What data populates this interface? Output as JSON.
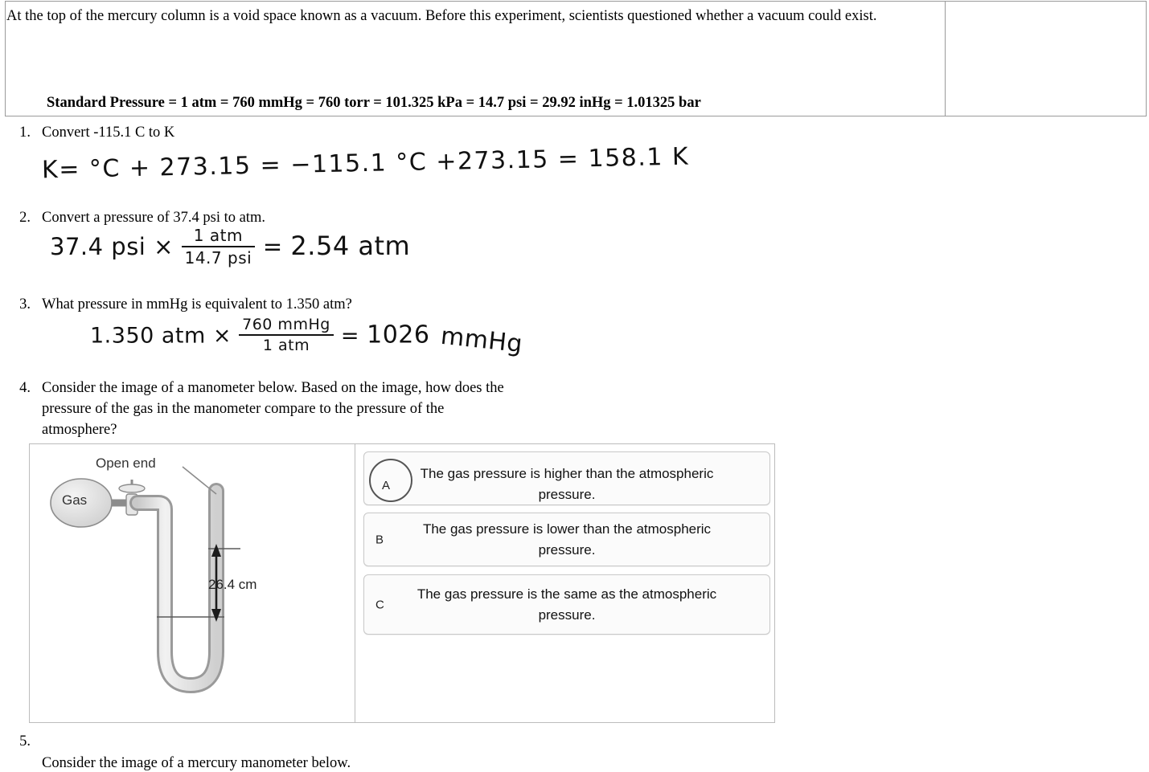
{
  "top": {
    "paragraph": "At the top of the mercury column is a void space known as a vacuum. Before this experiment, scientists questioned whether a vacuum could exist.",
    "standard_pressure": "Standard Pressure = 1 atm = 760 mmHg = 760 torr = 101.325 kPa = 14.7 psi = 29.92 inHg = 1.01325 bar"
  },
  "questions": [
    {
      "number": "1.",
      "text": "Convert -115.1 C to K"
    },
    {
      "number": "2.",
      "text": "Convert a pressure of 37.4 psi to atm."
    },
    {
      "number": "3.",
      "text": "What pressure in mmHg is equivalent to 1.350 atm?"
    },
    {
      "number": "4.",
      "text": "Consider the image of a manometer below. Based on the image, how does the pressure of the gas in the manometer compare to the pressure of the atmosphere?"
    },
    {
      "number": "5.",
      "text": "Consider the image of a mercury manometer below."
    }
  ],
  "handwriting": {
    "q1": {
      "a": "K=",
      "b": "°C + 273.15 =",
      "c": "−115.1 °C +273.15 =",
      "d": "158.1 K"
    },
    "q2": {
      "given": "37.4 psi  ×",
      "frac_top": "1 atm",
      "frac_bot": "14.7 psi",
      "equals": "=",
      "answer": "2.54 atm"
    },
    "q3": {
      "given": "1.350 atm  ×",
      "frac_top": "760 mmHg",
      "frac_bot": "1 atm",
      "equals": "=",
      "answer": "1026",
      "answer_unit": "mmHg"
    }
  },
  "figure": {
    "open_end_label": "Open end",
    "gas_label": "Gas",
    "distance_label": "26.4 cm"
  },
  "answer_options": [
    {
      "letter": "A",
      "text": "The gas pressure is higher than the atmospheric pressure.",
      "selected": true
    },
    {
      "letter": "B",
      "text": "The gas pressure is lower than the atmospheric pressure.",
      "selected": false
    },
    {
      "letter": "C",
      "text": "The gas pressure is the same as the atmospheric pressure.",
      "selected": false
    }
  ]
}
